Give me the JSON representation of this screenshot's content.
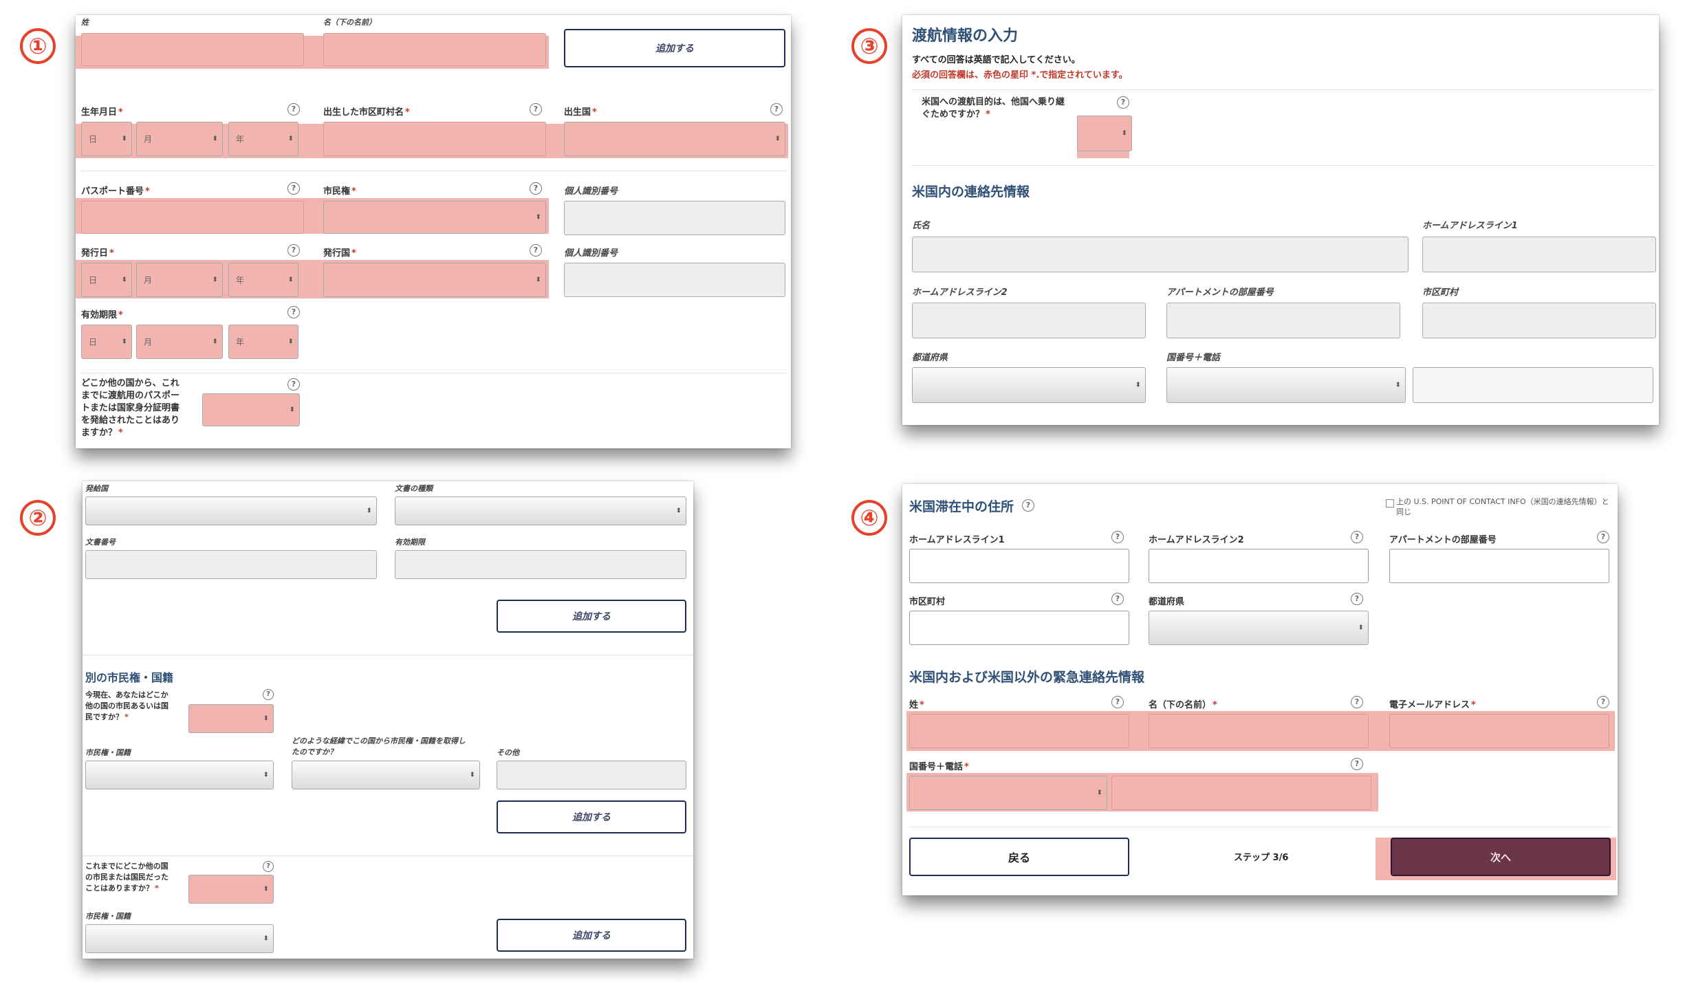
{
  "badges": [
    "①",
    "②",
    "③",
    "④"
  ],
  "p1": {
    "surname": "姓",
    "given_name": "名（下の名前）",
    "add_button": "追加する",
    "dob": "生年月日",
    "birth_city": "出生した市区町村名",
    "birth_country": "出生国",
    "day": "日",
    "month": "月",
    "year": "年",
    "passport_no": "パスポート番号",
    "citizenship": "市民権",
    "national_id": "個人識別番号",
    "issue_date": "発行日",
    "issue_country": "発行国",
    "national_id2": "個人識別番号",
    "expiry": "有効期限",
    "other_passport_q": "どこか他の国から、これまでに渡航用のパスポートまたは国家身分証明書を発給されたことはありますか？"
  },
  "p2": {
    "issuing_country": "発給国",
    "doc_type": "文書の種類",
    "doc_number": "文書番号",
    "expiry": "有効期限",
    "add_button": "追加する",
    "other_citizenship_title": "別の市民権・国籍",
    "current_citizen_q": "今現在、あなたはどこか他の国の市民あるいは国民ですか？",
    "citizenship": "市民権・国籍",
    "how_acquired": "どのような経緯でこの国から市民権・国籍を取得したのですか？",
    "other": "その他",
    "add_button2": "追加する",
    "past_citizen_q": "これまでにどこか他の国の市民または国民だったことはありますか？",
    "citizenship2": "市民権・国籍",
    "add_button3": "追加する"
  },
  "p3": {
    "title": "渡航情報の入力",
    "instruction": "すべての回答は英語で記入してください。",
    "required_note": "必須の回答欄は、赤色の星印 *.で指定されています。",
    "transit_q": "米国への渡航目的は、他国へ乗り継ぐためですか？",
    "contact_title": "米国内の連絡先情報",
    "name": "氏名",
    "address1": "ホームアドレスライン1",
    "address2": "ホームアドレスライン2",
    "apt": "アパートメントの部屋番号",
    "city": "市区町村",
    "state": "都道府県",
    "phone": "国番号＋電話"
  },
  "p4": {
    "address_title": "米国滞在中の住所",
    "same_as": "上の U.S. POINT OF CONTACT INFO（米国の連絡先情報）と同じ",
    "address1": "ホームアドレスライン1",
    "address2": "ホームアドレスライン2",
    "apt": "アパートメントの部屋番号",
    "city": "市区町村",
    "state": "都道府県",
    "emergency_title": "米国内および米国以外の緊急連絡先情報",
    "surname": "姓",
    "given_name": "名（下の名前）",
    "email": "電子メールアドレス",
    "phone": "国番号＋電話",
    "back": "戻る",
    "step": "ステップ 3/6",
    "next": "次へ"
  },
  "req": "*",
  "help": "?",
  "arrow": "⬍",
  "colors": {
    "highlight": "#f2b4ae",
    "badge": "#e8412b",
    "section": "#2f5076",
    "next": "#6b3549",
    "required": "#c0392b"
  }
}
